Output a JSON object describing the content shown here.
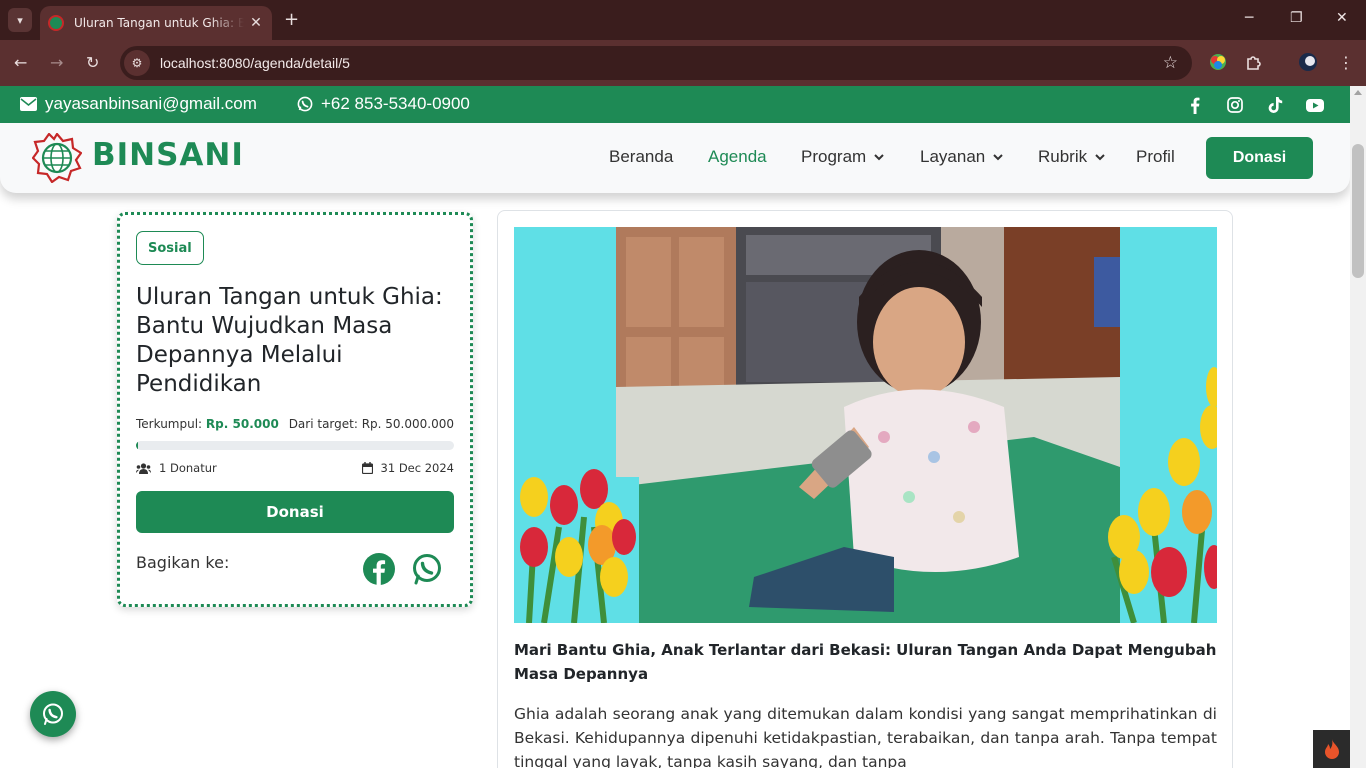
{
  "browser": {
    "tab_title": "Uluran Tangan untuk Ghia: Bantu Wujudkan Masa Depannya Melalui Pendidikan",
    "url": "localhost:8080/agenda/detail/5",
    "new_tab_symbol": "+",
    "close_tab_symbol": "✕"
  },
  "topbar": {
    "email": "yayasanbinsani@gmail.com",
    "phone": "+62 853-5340-0900",
    "social_icons": [
      "facebook-icon",
      "instagram-icon",
      "tiktok-icon",
      "youtube-icon"
    ]
  },
  "navbar": {
    "brand": "BINSANI",
    "links": [
      {
        "label": "Beranda",
        "active": false
      },
      {
        "label": "Agenda",
        "active": true
      },
      {
        "label": "Program",
        "dropdown": true
      },
      {
        "label": "Layanan",
        "dropdown": true
      },
      {
        "label": "Rubrik",
        "dropdown": true
      },
      {
        "label": "Profil",
        "active": false
      }
    ],
    "cta": "Donasi"
  },
  "campaign": {
    "category": "Sosial",
    "title": "Uluran Tangan untuk Ghia: Bantu Wujudkan Masa Depannya Melalui Pendidikan",
    "collected_label": "Terkumpul:",
    "collected_amount": "Rp. 50.000",
    "target_label": "Dari target: Rp. 50.000.000",
    "progress_fraction": 0.001,
    "donors": "1 Donatur",
    "date": "31 Dec 2024",
    "donate_button": "Donasi",
    "share_label": "Bagikan ke:"
  },
  "article": {
    "heading": "Mari Bantu Ghia, Anak Terlantar dari Bekasi: Uluran Tangan Anda Dapat Mengubah Masa Depannya",
    "body": "Ghia adalah seorang anak yang ditemukan dalam kondisi yang sangat memprihatinkan di Bekasi. Kehidupannya dipenuhi ketidakpastian, terabaikan, dan tanpa arah. Tanpa tempat tinggal yang layak, tanpa kasih sayang, dan tanpa"
  },
  "colors": {
    "brand_green": "#1e8a55",
    "browser_dark": "#3a1d1d",
    "browser_bar": "#5b3030",
    "hero_bg": "#5fdfe6"
  }
}
